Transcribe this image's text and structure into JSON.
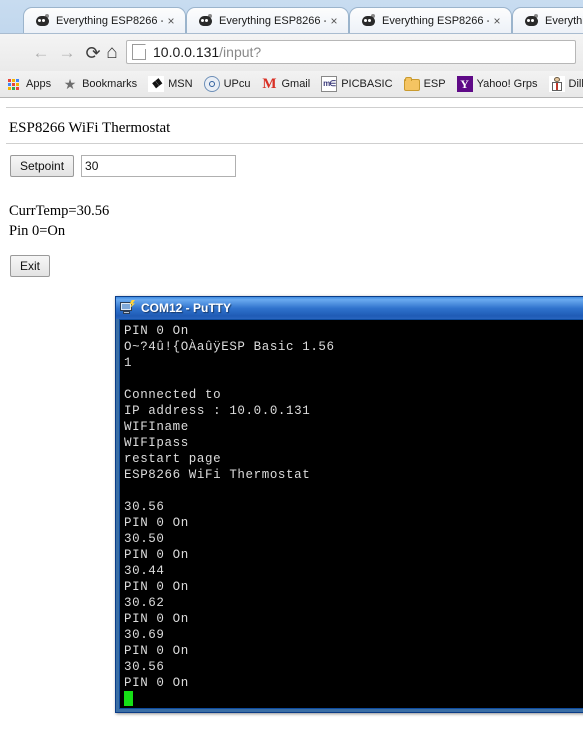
{
  "browser": {
    "tabs": [
      {
        "title": "Everything ESP8266 -",
        "favicon": "site-favicon",
        "close": "×"
      },
      {
        "title": "Everything ESP8266 -",
        "favicon": "site-favicon",
        "close": "×"
      },
      {
        "title": "Everything ESP8266 -",
        "favicon": "site-favicon",
        "close": "×"
      },
      {
        "title": "Everything",
        "favicon": "site-favicon",
        "close": "×"
      }
    ],
    "toolbar": {
      "back": "←",
      "forward": "→",
      "reload": "⟳",
      "home": "⌂"
    },
    "omnibox": {
      "url_host": "10.0.0.131",
      "url_path": "/input?",
      "page_icon": "page-icon"
    },
    "bookmarks": [
      {
        "label": "Apps",
        "icon": "apps-grid-icon"
      },
      {
        "label": "Bookmarks",
        "icon": "star-icon"
      },
      {
        "label": "MSN",
        "icon": "msn-butterfly-icon"
      },
      {
        "label": "UPcu",
        "icon": "upcu-icon"
      },
      {
        "label": "Gmail",
        "icon": "gmail-icon"
      },
      {
        "label": "PICBASIC",
        "icon": "picbasic-icon"
      },
      {
        "label": "ESP",
        "icon": "folder-icon"
      },
      {
        "label": "Yahoo! Grps",
        "icon": "yahoo-icon"
      },
      {
        "label": "Dilb",
        "icon": "dilbert-icon"
      }
    ]
  },
  "page": {
    "heading": "ESP8266 WiFi Thermostat",
    "setpoint_button": "Setpoint",
    "setpoint_value": "30",
    "status_lines": [
      "CurrTemp=30.56",
      "Pin 0=On"
    ],
    "exit_button": "Exit"
  },
  "putty": {
    "title": "COM12 - PuTTY",
    "icon": "putty-computer-icon",
    "lines": [
      "PIN 0 On",
      "O~?4û!{OÀaûÿESP Basic 1.56",
      "1",
      "",
      "Connected to",
      "IP address : 10.0.0.131",
      "WIFIname",
      "WIFIpass",
      "restart page",
      "ESP8266 WiFi Thermostat",
      "",
      "30.56",
      "PIN 0 On",
      "30.50",
      "PIN 0 On",
      "30.44",
      "PIN 0 On",
      "30.62",
      "PIN 0 On",
      "30.69",
      "PIN 0 On",
      "30.56",
      "PIN 0 On"
    ],
    "cursor": "block-cursor",
    "cursor_color": "#16e016"
  }
}
